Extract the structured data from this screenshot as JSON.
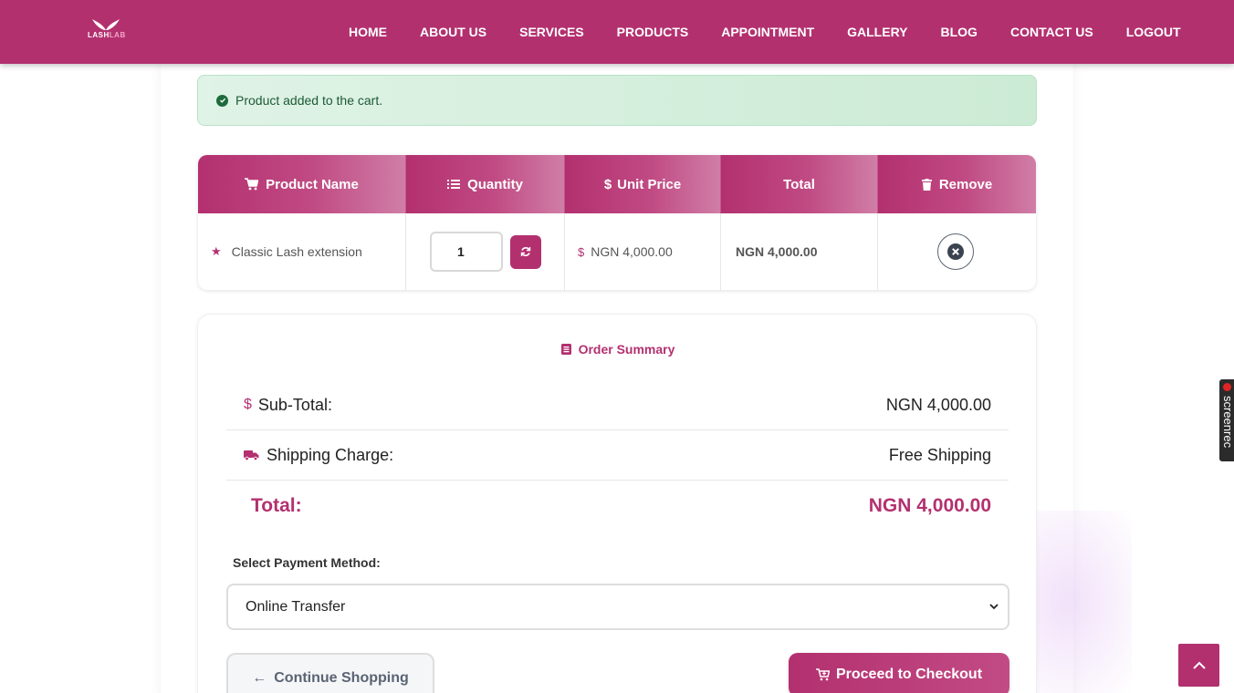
{
  "brand": {
    "logo_text_a": "LASH",
    "logo_text_b": "LAB"
  },
  "nav": {
    "items": [
      {
        "label": "HOME"
      },
      {
        "label": "ABOUT US"
      },
      {
        "label": "SERVICES"
      },
      {
        "label": "PRODUCTS"
      },
      {
        "label": "APPOINTMENT"
      },
      {
        "label": "GALLERY"
      },
      {
        "label": "BLOG"
      },
      {
        "label": "CONTACT US"
      },
      {
        "label": "LOGOUT"
      }
    ]
  },
  "alert": {
    "message": "Product added to the cart."
  },
  "cart": {
    "headers": {
      "product": "Product Name",
      "quantity": "Quantity",
      "unit_price": "Unit Price",
      "total": "Total",
      "remove": "Remove"
    },
    "rows": [
      {
        "product": "Classic Lash extension",
        "quantity": "1",
        "unit_price": "NGN 4,000.00",
        "total": "NGN 4,000.00"
      }
    ]
  },
  "summary": {
    "title": "Order Summary",
    "subtotal_label": "Sub-Total:",
    "subtotal_value": "NGN 4,000.00",
    "shipping_label": "Shipping Charge:",
    "shipping_value": "Free Shipping",
    "total_label": "Total:",
    "total_value": "NGN 4,000.00",
    "payment_label": "Select Payment Method:",
    "payment_selected": "Online Transfer",
    "continue_label": "Continue Shopping",
    "checkout_label": "Proceed to Checkout"
  },
  "overlay": {
    "screenrec_label": "screenrec"
  },
  "colors": {
    "brand": "#b3306f",
    "alert_bg": "#d4eddb",
    "alert_text": "#1d5a35"
  }
}
